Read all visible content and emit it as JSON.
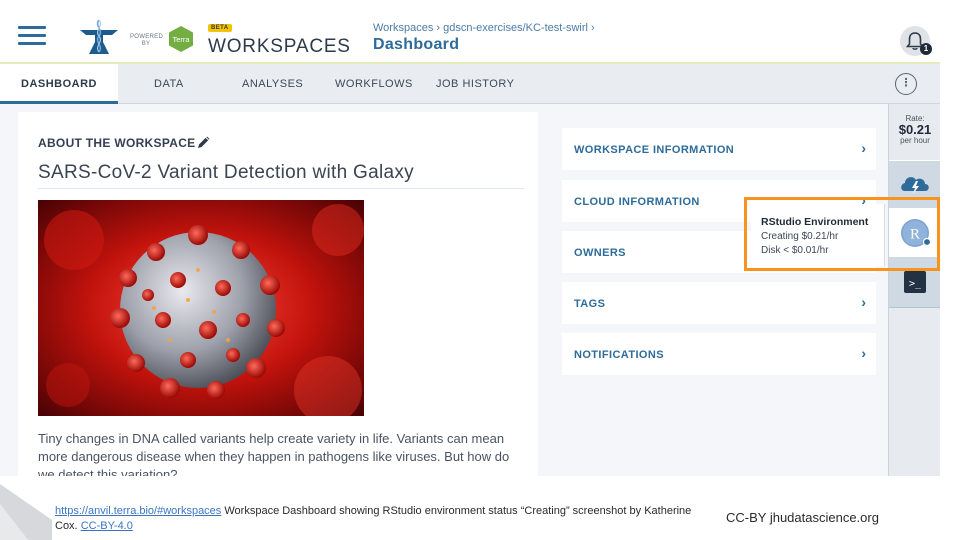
{
  "header": {
    "powered_by": "POWERED BY",
    "terra_label": "Terra",
    "beta_label": "BETA",
    "app_title": "WORKSPACES",
    "breadcrumb": "Workspaces › gdscn-exercises/KC-test-swirl ›",
    "page_title": "Dashboard",
    "notification_count": "1",
    "icons": {
      "menu": "hamburger-menu-icon",
      "logo": "anvil-logo",
      "bell": "bell-icon"
    }
  },
  "tabs": [
    {
      "label": "DASHBOARD",
      "active": true
    },
    {
      "label": "DATA",
      "active": false
    },
    {
      "label": "ANALYSES",
      "active": false
    },
    {
      "label": "WORKFLOWS",
      "active": false
    },
    {
      "label": "JOB HISTORY",
      "active": false
    }
  ],
  "tabs_menu_glyph": "⋮",
  "about": {
    "heading": "ABOUT THE WORKSPACE",
    "title": "SARS-CoV-2 Variant Detection with Galaxy",
    "description": "Tiny changes in DNA called variants help create variety in life. Variants can mean more dangerous disease when they happen in pathogens like viruses. But how do we detect this variation?"
  },
  "info_sections": [
    {
      "label": "WORKSPACE INFORMATION",
      "chevron": "›"
    },
    {
      "label": "CLOUD INFORMATION",
      "chevron": "›"
    },
    {
      "label": "OWNERS",
      "chevron": "›"
    },
    {
      "label": "TAGS",
      "chevron": "›"
    },
    {
      "label": "NOTIFICATIONS",
      "chevron": "›"
    }
  ],
  "rail": {
    "rate_label": "Rate:",
    "rate_value": "$0.21",
    "rate_unit": "per hour",
    "rstudio_letter": "R",
    "terminal_glyph": ">_"
  },
  "popup": {
    "title": "RStudio Environment",
    "status_line": "Creating $0.21/hr",
    "disk_line": "Disk < $0.01/hr"
  },
  "footer": {
    "url_text": "https://anvil.terra.bio/#workspaces",
    "caption": " Workspace Dashboard showing RStudio environment status “Creating” screenshot by Katherine Cox. ",
    "license_link": "CC-BY-4.0",
    "license_right": "CC-BY  jhudatascience.org"
  },
  "colors": {
    "accent_blue": "#2d6b9a",
    "highlight_orange": "#f7941d",
    "terra_green": "#74ae43",
    "beta_yellow": "#f4c400"
  }
}
